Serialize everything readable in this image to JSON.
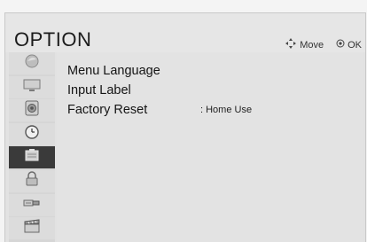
{
  "header": {
    "title": "OPTION",
    "move_label": "Move",
    "ok_label": "OK"
  },
  "sidebar": {
    "items": [
      {
        "icon": "picture-icon"
      },
      {
        "icon": "screen-icon"
      },
      {
        "icon": "speaker-icon"
      },
      {
        "icon": "clock-icon"
      },
      {
        "icon": "option-icon",
        "active": true
      },
      {
        "icon": "lock-icon"
      },
      {
        "icon": "usb-icon"
      },
      {
        "icon": "clapboard-icon"
      }
    ]
  },
  "menu": {
    "items": [
      {
        "label": "Menu Language"
      },
      {
        "label": "Input Label"
      },
      {
        "label": "Factory Reset",
        "value": ": Home Use"
      }
    ]
  },
  "colors": {
    "active_item": "#3a3a3a",
    "panel": "#e3e3e3"
  }
}
